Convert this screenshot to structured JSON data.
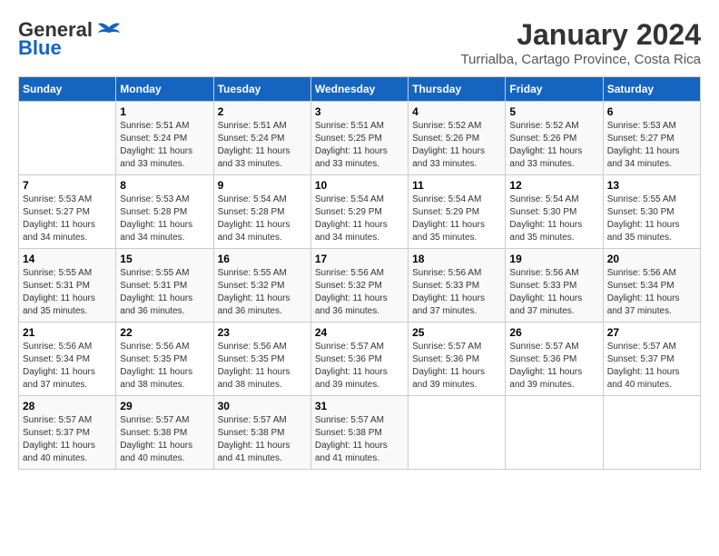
{
  "header": {
    "logo_line1": "General",
    "logo_line2": "Blue",
    "month": "January 2024",
    "location": "Turrialba, Cartago Province, Costa Rica"
  },
  "days_of_week": [
    "Sunday",
    "Monday",
    "Tuesday",
    "Wednesday",
    "Thursday",
    "Friday",
    "Saturday"
  ],
  "weeks": [
    [
      {
        "day": "",
        "info": ""
      },
      {
        "day": "1",
        "info": "Sunrise: 5:51 AM\nSunset: 5:24 PM\nDaylight: 11 hours\nand 33 minutes."
      },
      {
        "day": "2",
        "info": "Sunrise: 5:51 AM\nSunset: 5:24 PM\nDaylight: 11 hours\nand 33 minutes."
      },
      {
        "day": "3",
        "info": "Sunrise: 5:51 AM\nSunset: 5:25 PM\nDaylight: 11 hours\nand 33 minutes."
      },
      {
        "day": "4",
        "info": "Sunrise: 5:52 AM\nSunset: 5:26 PM\nDaylight: 11 hours\nand 33 minutes."
      },
      {
        "day": "5",
        "info": "Sunrise: 5:52 AM\nSunset: 5:26 PM\nDaylight: 11 hours\nand 33 minutes."
      },
      {
        "day": "6",
        "info": "Sunrise: 5:53 AM\nSunset: 5:27 PM\nDaylight: 11 hours\nand 34 minutes."
      }
    ],
    [
      {
        "day": "7",
        "info": "Sunrise: 5:53 AM\nSunset: 5:27 PM\nDaylight: 11 hours\nand 34 minutes."
      },
      {
        "day": "8",
        "info": "Sunrise: 5:53 AM\nSunset: 5:28 PM\nDaylight: 11 hours\nand 34 minutes."
      },
      {
        "day": "9",
        "info": "Sunrise: 5:54 AM\nSunset: 5:28 PM\nDaylight: 11 hours\nand 34 minutes."
      },
      {
        "day": "10",
        "info": "Sunrise: 5:54 AM\nSunset: 5:29 PM\nDaylight: 11 hours\nand 34 minutes."
      },
      {
        "day": "11",
        "info": "Sunrise: 5:54 AM\nSunset: 5:29 PM\nDaylight: 11 hours\nand 35 minutes."
      },
      {
        "day": "12",
        "info": "Sunrise: 5:54 AM\nSunset: 5:30 PM\nDaylight: 11 hours\nand 35 minutes."
      },
      {
        "day": "13",
        "info": "Sunrise: 5:55 AM\nSunset: 5:30 PM\nDaylight: 11 hours\nand 35 minutes."
      }
    ],
    [
      {
        "day": "14",
        "info": "Sunrise: 5:55 AM\nSunset: 5:31 PM\nDaylight: 11 hours\nand 35 minutes."
      },
      {
        "day": "15",
        "info": "Sunrise: 5:55 AM\nSunset: 5:31 PM\nDaylight: 11 hours\nand 36 minutes."
      },
      {
        "day": "16",
        "info": "Sunrise: 5:55 AM\nSunset: 5:32 PM\nDaylight: 11 hours\nand 36 minutes."
      },
      {
        "day": "17",
        "info": "Sunrise: 5:56 AM\nSunset: 5:32 PM\nDaylight: 11 hours\nand 36 minutes."
      },
      {
        "day": "18",
        "info": "Sunrise: 5:56 AM\nSunset: 5:33 PM\nDaylight: 11 hours\nand 37 minutes."
      },
      {
        "day": "19",
        "info": "Sunrise: 5:56 AM\nSunset: 5:33 PM\nDaylight: 11 hours\nand 37 minutes."
      },
      {
        "day": "20",
        "info": "Sunrise: 5:56 AM\nSunset: 5:34 PM\nDaylight: 11 hours\nand 37 minutes."
      }
    ],
    [
      {
        "day": "21",
        "info": "Sunrise: 5:56 AM\nSunset: 5:34 PM\nDaylight: 11 hours\nand 37 minutes."
      },
      {
        "day": "22",
        "info": "Sunrise: 5:56 AM\nSunset: 5:35 PM\nDaylight: 11 hours\nand 38 minutes."
      },
      {
        "day": "23",
        "info": "Sunrise: 5:56 AM\nSunset: 5:35 PM\nDaylight: 11 hours\nand 38 minutes."
      },
      {
        "day": "24",
        "info": "Sunrise: 5:57 AM\nSunset: 5:36 PM\nDaylight: 11 hours\nand 39 minutes."
      },
      {
        "day": "25",
        "info": "Sunrise: 5:57 AM\nSunset: 5:36 PM\nDaylight: 11 hours\nand 39 minutes."
      },
      {
        "day": "26",
        "info": "Sunrise: 5:57 AM\nSunset: 5:36 PM\nDaylight: 11 hours\nand 39 minutes."
      },
      {
        "day": "27",
        "info": "Sunrise: 5:57 AM\nSunset: 5:37 PM\nDaylight: 11 hours\nand 40 minutes."
      }
    ],
    [
      {
        "day": "28",
        "info": "Sunrise: 5:57 AM\nSunset: 5:37 PM\nDaylight: 11 hours\nand 40 minutes."
      },
      {
        "day": "29",
        "info": "Sunrise: 5:57 AM\nSunset: 5:38 PM\nDaylight: 11 hours\nand 40 minutes."
      },
      {
        "day": "30",
        "info": "Sunrise: 5:57 AM\nSunset: 5:38 PM\nDaylight: 11 hours\nand 41 minutes."
      },
      {
        "day": "31",
        "info": "Sunrise: 5:57 AM\nSunset: 5:38 PM\nDaylight: 11 hours\nand 41 minutes."
      },
      {
        "day": "",
        "info": ""
      },
      {
        "day": "",
        "info": ""
      },
      {
        "day": "",
        "info": ""
      }
    ]
  ]
}
